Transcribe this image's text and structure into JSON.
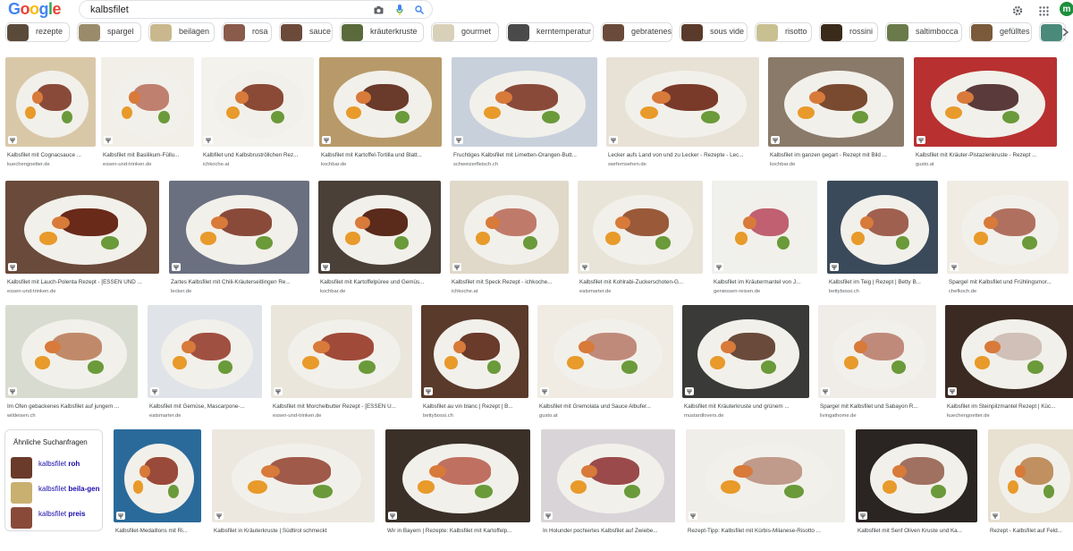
{
  "logo": [
    "G",
    "o",
    "o",
    "g",
    "l",
    "e"
  ],
  "search": {
    "query": "kalbsfilet"
  },
  "account": {
    "initial": "m"
  },
  "chips": [
    {
      "label": "rezepte",
      "w": 72,
      "c": "#5a4a3a"
    },
    {
      "label": "spargel",
      "w": 72,
      "c": "#9a8c6a"
    },
    {
      "label": "beilagen",
      "w": 74,
      "c": "#c9b88d"
    },
    {
      "label": "rosa",
      "w": 56,
      "c": "#8a5a4a"
    },
    {
      "label": "sauce",
      "w": 60,
      "c": "#6b4a3a"
    },
    {
      "label": "kräuterkruste",
      "w": 94,
      "c": "#5a6a3a"
    },
    {
      "label": "gourmet",
      "w": 76,
      "c": "#d8d0b8"
    },
    {
      "label": "kerntemperatur",
      "w": 98,
      "c": "#4a4a4a"
    },
    {
      "label": "gebratenes",
      "w": 80,
      "c": "#6a4a3a"
    },
    {
      "label": "sous vide",
      "w": 76,
      "c": "#5a3a2a"
    },
    {
      "label": "risotto",
      "w": 64,
      "c": "#c8c090"
    },
    {
      "label": "rossini",
      "w": 66,
      "c": "#3a2a1a"
    },
    {
      "label": "saltimbocca",
      "w": 86,
      "c": "#6a7a4a"
    },
    {
      "label": "gefülltes",
      "w": 70,
      "c": "#7a5a3a"
    },
    {
      "label": "",
      "w": 30,
      "c": "#4a8a7a"
    }
  ],
  "rows": [
    [
      {
        "cap": "Kalbsfilet mit Cognacsauce ...",
        "src": "kuechengoetter.de",
        "w": 101,
        "bg": "#d9c8a8",
        "m": "#8a4a3a"
      },
      {
        "cap": "Kalbsfilet mit Basilikum-Füllu...",
        "src": "essen-und-trinken.de",
        "w": 104,
        "bg": "#f1efe7",
        "m": "#c08070"
      },
      {
        "cap": "Kalbfilet und Kalbsbruströllchen Rez...",
        "src": "ichkoche.at",
        "w": 126,
        "bg": "#f4f2ec",
        "m": "#8a4a35"
      },
      {
        "cap": "Kalbsfilet mit Kartoffel-Tortilla und Blatt...",
        "src": "kochbar.de",
        "w": 137,
        "bg": "#b89a6a",
        "m": "#6a3a2a"
      },
      {
        "cap": "Fruchtiges Kalbsfilet mit Limetten-Orangen-Butt...",
        "src": "schweizerfleisch.ch",
        "w": 163,
        "bg": "#c8d0dc",
        "m": "#8a4a3a"
      },
      {
        "cap": "Lecker aufs Land von und zu Lecker - Rezepte - Lec...",
        "src": "swrfernsehen.de",
        "w": 171,
        "bg": "#e8e2d6",
        "m": "#7a3a2a"
      },
      {
        "cap": "Kalbsfilet im ganzen gegart - Rezept mit Bild ...",
        "src": "kochbar.de",
        "w": 152,
        "bg": "#8a7a6a",
        "m": "#7a4a30"
      },
      {
        "cap": "Kalbsfilet mit Kräuter-Pistazienkruste - Rezept ...",
        "src": "gusto.at",
        "w": 160,
        "bg": "#b83030",
        "m": "#5a3a3a"
      }
    ],
    [
      {
        "cap": "Kalbsfilet mit Lauch-Polenta Rezept - [ESSEN UND ...",
        "src": "essen-und-trinken.de",
        "w": 172,
        "bg": "#6a4a3a",
        "m": "#6a2a1a"
      },
      {
        "cap": "Zartes Kalbsfilet mit Chili-Kräuterseitlingen Re...",
        "src": "lecker.de",
        "w": 157,
        "bg": "#6a7080",
        "m": "#8a4a3a"
      },
      {
        "cap": "Kalbsfilet mit Kartoffelpüree und Gemüs...",
        "src": "kochbar.de",
        "w": 137,
        "bg": "#4a4038",
        "m": "#5a2a1a"
      },
      {
        "cap": "Kalbsfilet mit Speck Rezept - ichkoche...",
        "src": "ichkoche.at",
        "w": 133,
        "bg": "#e0d8c8",
        "m": "#c07a6a"
      },
      {
        "cap": "Kalbsfilet mit Kohlrabi-Zuckerschoten-G...",
        "src": "eatsmarter.de",
        "w": 140,
        "bg": "#e8e4d8",
        "m": "#9a5a3a"
      },
      {
        "cap": "Kalbsfilet im Kräutermantel von J...",
        "src": "geniessen-reisen.de",
        "w": 118,
        "bg": "#f0f0ec",
        "m": "#c06070"
      },
      {
        "cap": "Kalbsfilet im Teig | Rezept | Betty B...",
        "src": "bettybossi.ch",
        "w": 124,
        "bg": "#3a4a5a",
        "m": "#a06050"
      },
      {
        "cap": "Spargel mit Kalbsfilet und Frühlingsmor...",
        "src": "chefkoch.de",
        "w": 136,
        "bg": "#f0ece4",
        "m": "#b07060"
      }
    ],
    [
      {
        "cap": "Im Ofen gebackenes Kalbsfilet auf jungem ...",
        "src": "wildeisen.ch",
        "w": 148,
        "bg": "#d8dcd0",
        "m": "#c08a6a"
      },
      {
        "cap": "Kalbsfilet mit Gemüse, Mascarpone-...",
        "src": "eatsmarter.de",
        "w": 128,
        "bg": "#e0e4e8",
        "m": "#a05040"
      },
      {
        "cap": "Kalbsfilet mit Morchelbutter Rezept - [ESSEN U...",
        "src": "essen-und-trinken.de",
        "w": 158,
        "bg": "#eae6dc",
        "m": "#a04a3a"
      },
      {
        "cap": "Kalbsfilet au vin blanc | Rezept | B...",
        "src": "bettybossi.ch",
        "w": 120,
        "bg": "#5a3a2a",
        "m": "#6a3a2a"
      },
      {
        "cap": "Kalbsfilet mit Gremolata und Sauce Albufer...",
        "src": "gusto.at",
        "w": 152,
        "bg": "#f0ece4",
        "m": "#c08a7a"
      },
      {
        "cap": "Kalbsfilet mit Kräuterkruste und grünem ...",
        "src": "mustardlovers.de",
        "w": 142,
        "bg": "#3a3a38",
        "m": "#6a4a3a"
      },
      {
        "cap": "Spargel mit Kalbsfilet und Sabayon R...",
        "src": "livingathome.de",
        "w": 132,
        "bg": "#f0ece8",
        "m": "#c08a7a"
      },
      {
        "cap": "Kalbsfilet im Steinpilzmantel Rezept | Küc...",
        "src": "kuechengoetter.de",
        "w": 148,
        "bg": "#3a2a22",
        "m": "#d0c0b8"
      }
    ],
    [
      {
        "cap": "Kalbsfilet-Medaillons mit Ri...",
        "src": "",
        "w": 98,
        "bg": "#2a6a9a",
        "m": "#9a4a3a"
      },
      {
        "cap": "Kalbsfilet in Kräuterkruste | Südtirol schmeckt",
        "src": "",
        "w": 182,
        "bg": "#ece8e0",
        "m": "#a05a4a"
      },
      {
        "cap": "Wir in Bayern | Rezepte: Kalbsfilet mit Kartoffelp...",
        "src": "",
        "w": 162,
        "bg": "#3a3028",
        "m": "#c07060"
      },
      {
        "cap": "In Holunder pochiertes Kalbsfilet auf Zwiebe...",
        "src": "",
        "w": 150,
        "bg": "#d8d4d8",
        "m": "#9a4a4a"
      },
      {
        "cap": "Rezept-Tipp: Kalbsfilet mit Kürbis-Milanese-Risotto ...",
        "src": "",
        "w": 178,
        "bg": "#f0eee8",
        "m": "#c09a8a"
      },
      {
        "cap": "Kalbsfilet mit Senf Oliven Kruste und Ka...",
        "src": "",
        "w": 136,
        "bg": "#2a2422",
        "m": "#a07060"
      },
      {
        "cap": "Rezept - Kalbsfilet auf Feld...",
        "src": "",
        "w": 100,
        "bg": "#e8e0d0",
        "m": "#c09060"
      }
    ]
  ],
  "related": {
    "title": "Ähnliche Suchanfragen",
    "items": [
      {
        "pre": "kalbsfilet ",
        "bold": "roh"
      },
      {
        "pre": "kalbsfilet ",
        "bold": "beila-gen"
      },
      {
        "pre": "kalbsfilet ",
        "bold": "preis"
      }
    ]
  }
}
